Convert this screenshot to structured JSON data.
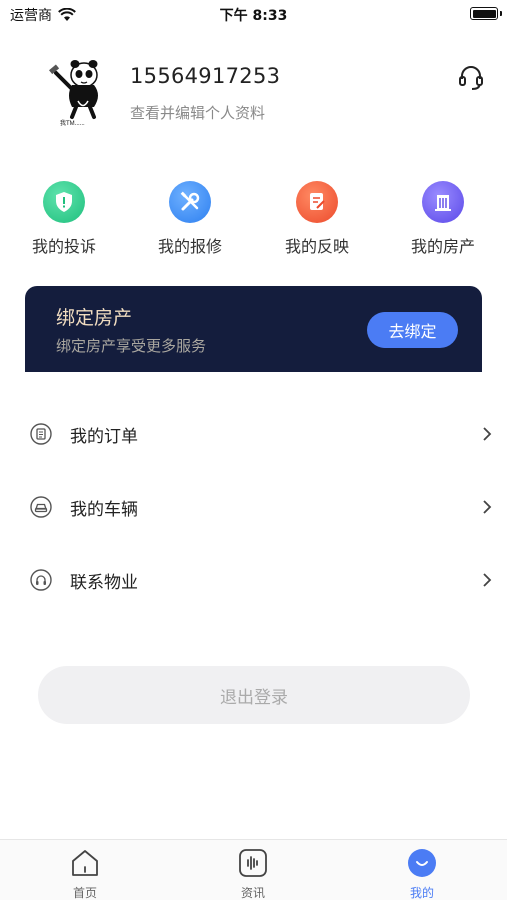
{
  "status_bar": {
    "carrier": "运营商",
    "time": "下午 8:33"
  },
  "profile": {
    "phone": "15564917253",
    "subtitle": "查看并编辑个人资料",
    "avatar_caption": "我TM......"
  },
  "quick_actions": [
    {
      "label": "我的投诉",
      "icon": "shield-icon",
      "color": "#2ecf8f"
    },
    {
      "label": "我的报修",
      "icon": "tools-icon",
      "color": "#3f8ff3"
    },
    {
      "label": "我的反映",
      "icon": "edit-note-icon",
      "color": "#f2603e"
    },
    {
      "label": "我的房产",
      "icon": "building-icon",
      "color": "#6d5ef0"
    }
  ],
  "banner": {
    "title": "绑定房产",
    "subtitle": "绑定房产享受更多服务",
    "button_label": "去绑定"
  },
  "menu": [
    {
      "label": "我的订单",
      "icon": "clipboard-icon"
    },
    {
      "label": "我的车辆",
      "icon": "car-icon"
    },
    {
      "label": "联系物业",
      "icon": "headset-icon"
    }
  ],
  "logout_label": "退出登录",
  "tabs": [
    {
      "label": "首页",
      "icon": "home-icon",
      "active": false
    },
    {
      "label": "资讯",
      "icon": "audio-wave-icon",
      "active": false
    },
    {
      "label": "我的",
      "icon": "profile-smile-icon",
      "active": true
    }
  ],
  "colors": {
    "accent": "#4b7cf4",
    "banner_bg": "#141d3d",
    "banner_title": "#f0dcc0"
  }
}
